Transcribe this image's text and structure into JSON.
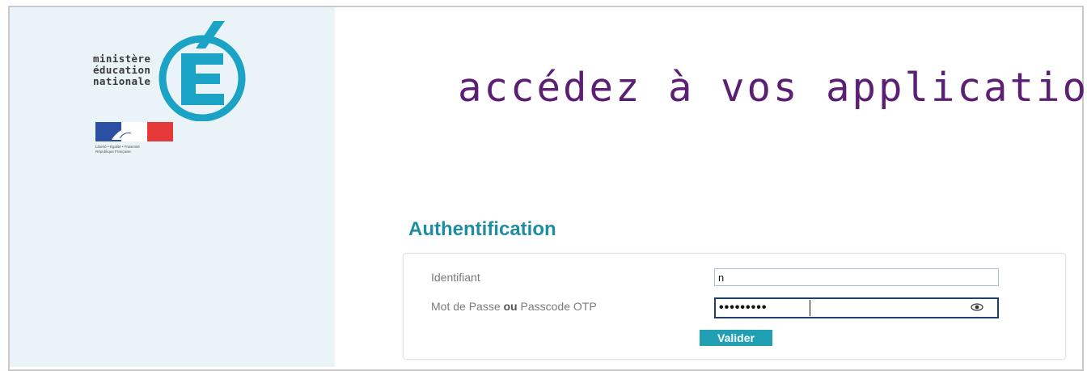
{
  "branding": {
    "ministry_lines": [
      "ministère",
      "éducation",
      "nationale"
    ],
    "logo_icon": "e-acute-circle-logo",
    "flag_icon": "marianne-tricolour-logo",
    "motto_lines": [
      "Liberté • Égalité • Fraternité",
      "République Française"
    ]
  },
  "headline": "accédez à vos applications",
  "auth": {
    "title": "Authentification",
    "identifiant_label": "Identifiant",
    "identifiant_value": "n",
    "password_label_before": "Mot de Passe ",
    "password_label_ou": "ou",
    "password_label_after": " Passcode OTP",
    "password_masked": "•••••••••",
    "eye_icon": "eye-icon",
    "submit_label": "Valider"
  },
  "colors": {
    "headline": "#5b1f74",
    "accent": "#1f8da0",
    "button": "#22a0b3",
    "left_panel": "#e9f3f8",
    "focus_border": "#1c3f6e"
  }
}
